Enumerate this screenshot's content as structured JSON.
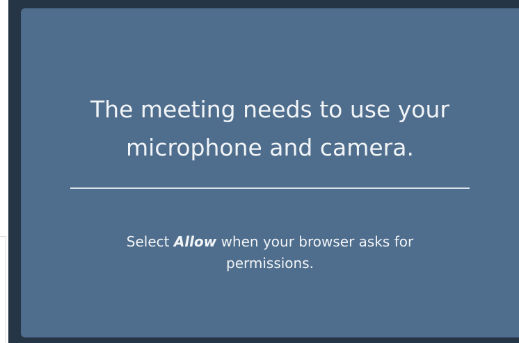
{
  "dialog": {
    "title_line1": "The meeting needs to use your",
    "title_line2": "microphone and camera.",
    "instruction_prefix": "Select",
    "instruction_emphasis": "Allow",
    "instruction_suffix_line1": "when your browser asks for",
    "instruction_line2": "permissions."
  },
  "colors": {
    "backdrop": "#253545",
    "dialog_background": "#4f6d8c",
    "text": "#f2f5f8",
    "divider": "#d9e1e9"
  }
}
